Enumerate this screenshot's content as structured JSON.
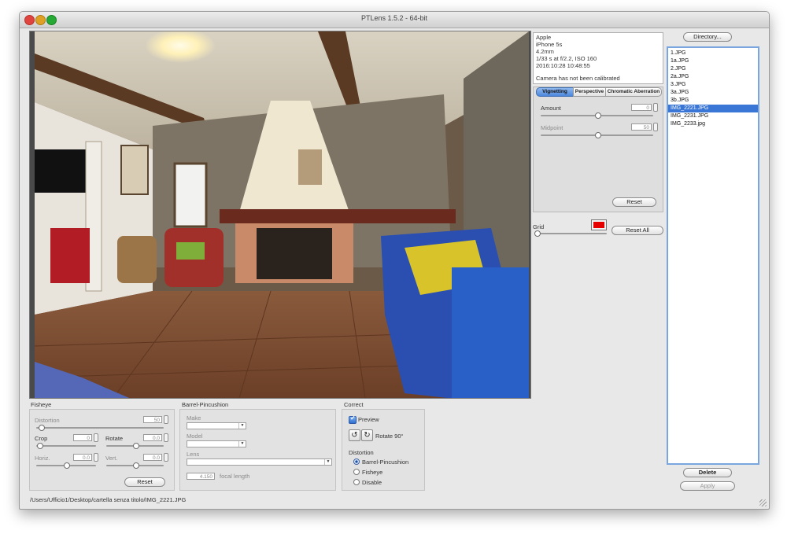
{
  "window": {
    "title": "PTLens 1.5.2 - 64-bit"
  },
  "exif": {
    "make": "Apple",
    "model": "iPhone 5s",
    "focal": "4.2mm",
    "exposure": "1/33 s at f/2.2, ISO 160",
    "datetime": "2016:10:28 10:48:55",
    "calibration": "Camera has not been calibrated"
  },
  "tabs": {
    "vignetting": "Vignetting",
    "perspective": "Perspective",
    "chromatic": "Chromatic Aberration"
  },
  "vignetting": {
    "amount_label": "Amount",
    "amount_value": "0",
    "amount_pos": 0.5,
    "midpoint_label": "Midpoint",
    "midpoint_value": "50",
    "midpoint_pos": 0.5,
    "reset": "Reset"
  },
  "grid": {
    "label": "Grid",
    "color": "#e50000",
    "reset_all": "Reset All",
    "pos": 0.0
  },
  "files": {
    "directory_button": "Directory...",
    "items": [
      "1.JPG",
      "1a.JPG",
      "2.JPG",
      "2a.JPG",
      "3.JPG",
      "3a.JPG",
      "3b.JPG",
      "IMG_2221.JPG",
      "IMG_2231.JPG",
      "IMG_2233.jpg"
    ],
    "selected_index": 7,
    "delete": "Delete",
    "apply": "Apply"
  },
  "fisheye": {
    "title": "Fisheye",
    "distortion_label": "Distortion",
    "distortion_value": "50",
    "distortion_pos": 0.02,
    "crop_label": "Crop",
    "crop_value": "0",
    "crop_pos": 0.02,
    "rotate_label": "Rotate",
    "rotate_value": "0.0",
    "rotate_pos": 0.5,
    "horiz_label": "Horiz.",
    "horiz_value": "0.0",
    "horiz_pos": 0.5,
    "vert_label": "Vert.",
    "vert_value": "0.0",
    "vert_pos": 0.5,
    "reset": "Reset"
  },
  "barrel": {
    "title": "Barrel-Pincushion",
    "make_label": "Make",
    "model_label": "Model",
    "lens_label": "Lens",
    "focal_value": "4.150",
    "focal_label": "focal length"
  },
  "correct": {
    "title": "Correct",
    "preview_label": "Preview",
    "rotate_label": "Rotate 90°",
    "distortion_label": "Distortion",
    "options": [
      "Barrel-Pincushion",
      "Fisheye",
      "Disable"
    ],
    "selected": 0
  },
  "status": {
    "path": "/Users/Ufficio1/Desktop/cartella senza titolo/IMG_2221.JPG"
  },
  "colors": {
    "selection": "#3a76d6",
    "close": "#e0443e",
    "minimize": "#dea123",
    "zoom": "#27aa35"
  }
}
